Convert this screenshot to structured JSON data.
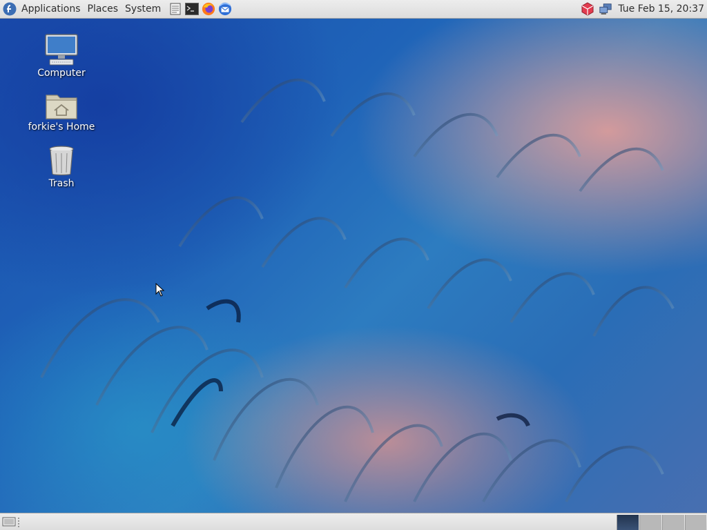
{
  "top_panel": {
    "menus": {
      "applications": "Applications",
      "places": "Places",
      "system": "System"
    },
    "launchers": [
      "text-editor-icon",
      "terminal-icon",
      "firefox-icon",
      "thunderbird-icon"
    ],
    "clock": "Tue Feb 15, 20:37"
  },
  "desktop": {
    "icons": [
      {
        "label": "Computer",
        "icon": "computer-icon"
      },
      {
        "label": "forkie's Home",
        "icon": "home-folder-icon"
      },
      {
        "label": "Trash",
        "icon": "trash-icon"
      }
    ]
  },
  "bottom_panel": {
    "workspaces": 4,
    "active_workspace": 1
  },
  "colors": {
    "panel_bg": "#e4e4e4",
    "wallpaper_blue": "#1f63b8",
    "wallpaper_pink": "#f0a096"
  }
}
